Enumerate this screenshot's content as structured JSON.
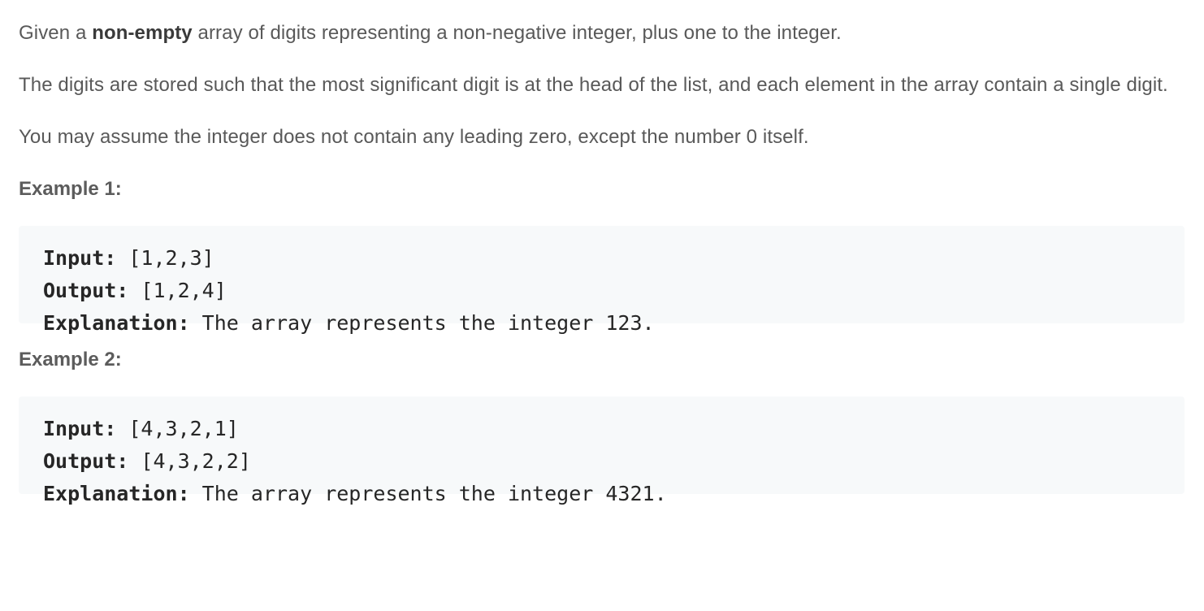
{
  "intro": {
    "p1_before": "Given a ",
    "p1_bold": "non-empty",
    "p1_after": " array of digits representing a non-negative integer, plus one to the integer.",
    "p2": "The digits are stored such that the most significant digit is at the head of the list, and each element in the array contain a single digit.",
    "p3": "You may assume the integer does not contain any leading zero, except the number 0 itself."
  },
  "examples": [
    {
      "heading": "Example 1:",
      "input_label": "Input:",
      "input_value": " [1,2,3]",
      "output_label": "Output:",
      "output_value": " [1,2,4]",
      "explanation_label": "Explanation:",
      "explanation_value": " The array represents the integer 123."
    },
    {
      "heading": "Example 2:",
      "input_label": "Input:",
      "input_value": " [4,3,2,1]",
      "output_label": "Output:",
      "output_value": " [4,3,2,2]",
      "explanation_label": "Explanation:",
      "explanation_value": " The array represents the integer 4321."
    }
  ]
}
